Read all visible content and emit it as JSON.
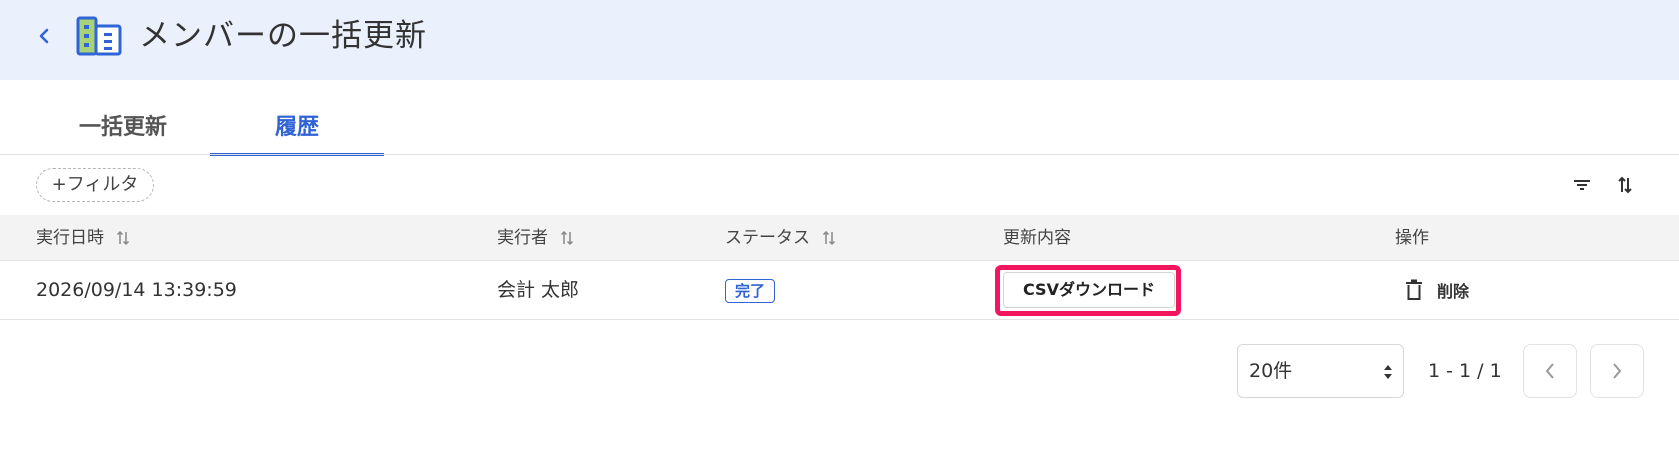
{
  "header": {
    "title": "メンバーの一括更新",
    "icon": "building-icon",
    "icon_color": "#2f63d6",
    "icon_accent": "#a8d27a"
  },
  "tabs": [
    {
      "label": "一括更新",
      "active": false
    },
    {
      "label": "履歴",
      "active": true
    }
  ],
  "toolbar": {
    "filter_label": "+フィルタ"
  },
  "table": {
    "columns": [
      "実行日時",
      "実行者",
      "ステータス",
      "更新内容",
      "操作"
    ],
    "rows": [
      {
        "executed_at": "2026/09/14 13:39:59",
        "executor": "会計 太郎",
        "status": "完了",
        "content_button": "CSVダウンロード",
        "action_label": "削除"
      }
    ]
  },
  "pagination": {
    "per_page": "20件",
    "range": "1 - 1 / 1"
  },
  "colors": {
    "accent": "#2f63d6",
    "highlight": "#f2165e",
    "header_bg": "#eaf1fc"
  }
}
